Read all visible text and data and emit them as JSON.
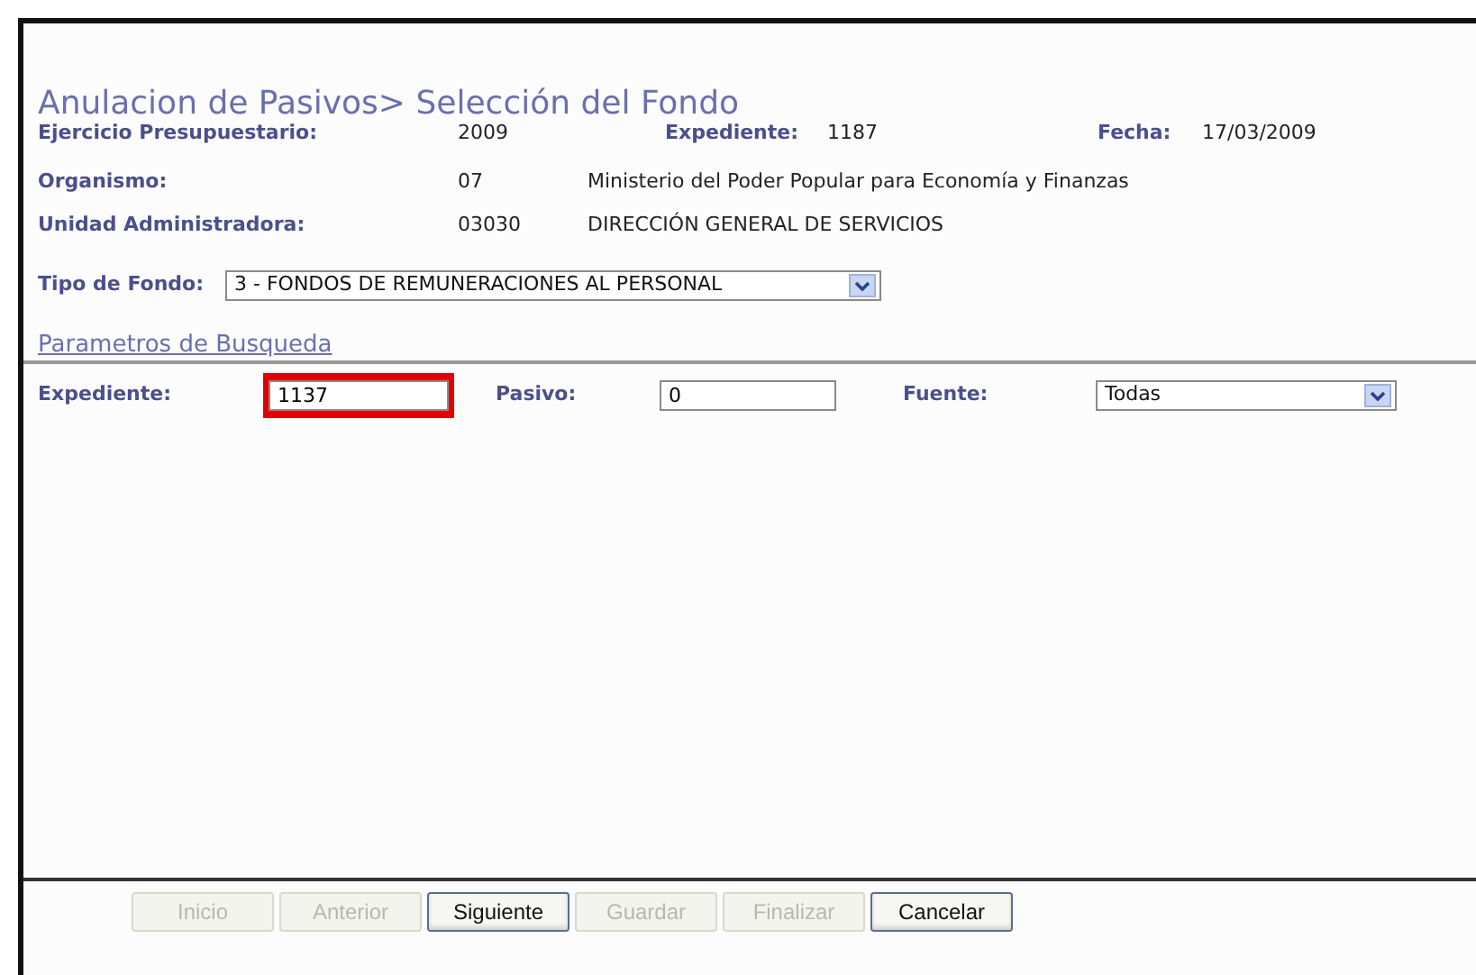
{
  "title": "Anulacion de Pasivos> Selección del Fondo",
  "info": {
    "ejercicio": {
      "label": "Ejercicio Presupuestario:",
      "value": "2009"
    },
    "expediente": {
      "label": "Expediente:",
      "value": "1187"
    },
    "fecha": {
      "label": "Fecha:",
      "value": "17/03/2009"
    },
    "organismo": {
      "label": "Organismo:",
      "code": "07",
      "name": "Ministerio del Poder Popular para Economía y Finanzas"
    },
    "unidad": {
      "label": "Unidad Administradora:",
      "code": "03030",
      "name": "DIRECCIÓN GENERAL DE SERVICIOS"
    }
  },
  "tipo_fondo": {
    "label": "Tipo de Fondo:",
    "value": "3 - FONDOS DE REMUNERACIONES AL PERSONAL"
  },
  "search": {
    "heading": "Parametros de Busqueda",
    "expediente": {
      "label": "Expediente:",
      "value": "1137",
      "highlighted": true
    },
    "pasivo": {
      "label": "Pasivo:",
      "value": "0"
    },
    "fuente": {
      "label": "Fuente:",
      "value": "Todas"
    }
  },
  "buttons": [
    {
      "label": "Inicio",
      "disabled": true
    },
    {
      "label": "Anterior",
      "disabled": true
    },
    {
      "label": "Siguiente",
      "disabled": false
    },
    {
      "label": "Guardar",
      "disabled": true
    },
    {
      "label": "Finalizar",
      "disabled": true
    },
    {
      "label": "Cancelar",
      "disabled": false
    }
  ]
}
